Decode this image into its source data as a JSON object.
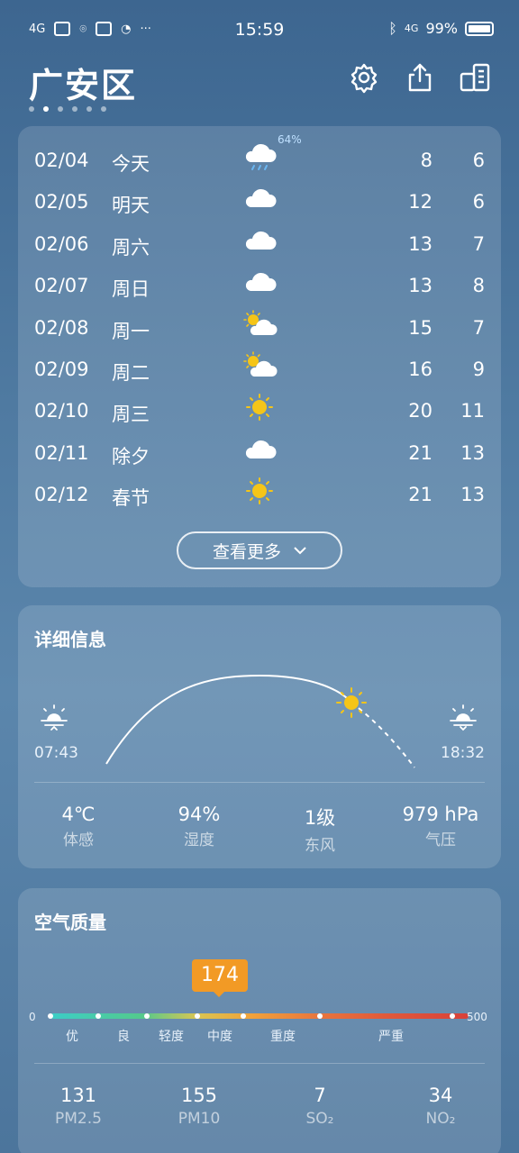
{
  "status_bar": {
    "network_left": "4G",
    "time": "15:59",
    "network_right": "4G",
    "battery": "99%"
  },
  "header": {
    "city": "广安区",
    "page_count": 6,
    "active_page": 2
  },
  "forecast": {
    "days": [
      {
        "date": "02/04",
        "day": "今天",
        "icon": "cloud-rain-icon",
        "pop": "64%",
        "high": "8",
        "low": "6"
      },
      {
        "date": "02/05",
        "day": "明天",
        "icon": "cloud-icon",
        "pop": "",
        "high": "12",
        "low": "6"
      },
      {
        "date": "02/06",
        "day": "周六",
        "icon": "cloud-icon",
        "pop": "",
        "high": "13",
        "low": "7"
      },
      {
        "date": "02/07",
        "day": "周日",
        "icon": "cloud-icon",
        "pop": "",
        "high": "13",
        "low": "8"
      },
      {
        "date": "02/08",
        "day": "周一",
        "icon": "partly-cloudy-icon",
        "pop": "",
        "high": "15",
        "low": "7"
      },
      {
        "date": "02/09",
        "day": "周二",
        "icon": "partly-cloudy-icon",
        "pop": "",
        "high": "16",
        "low": "9"
      },
      {
        "date": "02/10",
        "day": "周三",
        "icon": "sun-icon",
        "pop": "",
        "high": "20",
        "low": "11"
      },
      {
        "date": "02/11",
        "day": "除夕",
        "icon": "cloud-icon",
        "pop": "",
        "high": "21",
        "low": "13"
      },
      {
        "date": "02/12",
        "day": "春节",
        "icon": "sun-icon",
        "pop": "",
        "high": "21",
        "low": "13"
      }
    ],
    "more_label": "查看更多"
  },
  "detail": {
    "title": "详细信息",
    "sunrise": "07:43",
    "sunset": "18:32",
    "stats": [
      {
        "value": "4℃",
        "label": "体感"
      },
      {
        "value": "94%",
        "label": "湿度"
      },
      {
        "value": "1级",
        "label": "东风"
      },
      {
        "value": "979 hPa",
        "label": "气压"
      }
    ]
  },
  "air": {
    "title": "空气质量",
    "aqi": "174",
    "min": "0",
    "max": "500",
    "levels": [
      "优",
      "良",
      "轻度",
      "中度",
      "重度",
      "严重"
    ],
    "pollutants": [
      {
        "value": "131",
        "label": "PM2.5"
      },
      {
        "value": "155",
        "label": "PM10"
      },
      {
        "value": "7",
        "label": "SO₂"
      },
      {
        "value": "34",
        "label": "NO₂"
      }
    ]
  },
  "colors": {
    "sun": "#f5c518",
    "aqi_badge": "#f29a25"
  }
}
